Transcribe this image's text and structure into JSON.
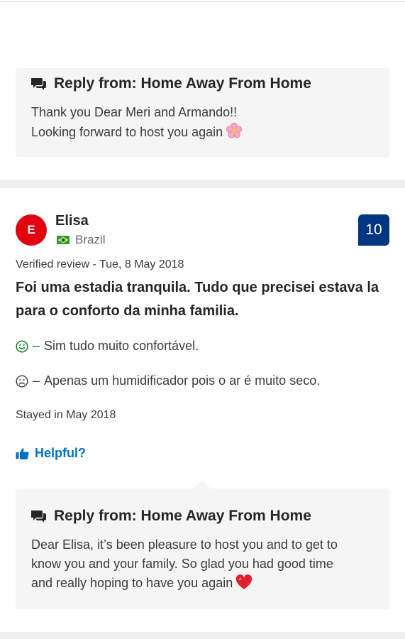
{
  "reply_1": {
    "heading": "Reply from: Home Away From Home",
    "line_1": "Thank you Dear Meri and Armando!!",
    "line_2": "Looking forward to host you again",
    "emoji_icon": "cherry-blossom-icon"
  },
  "review": {
    "avatar_letter": "E",
    "reviewer_name": "Elisa",
    "country": "Brazil",
    "flag_icon": "brazil-flag-icon",
    "score": "10",
    "verified": "Verified review - Tue, 8 May 2018",
    "title": "Foi uma estadia tranquila. Tudo que precisei estava la para o conforto da minha familia.",
    "pro_dash": "–",
    "pro_text": "Sim tudo muito confortável.",
    "con_dash": "–",
    "con_text": "Apenas um humidificador pois o ar é muito seco.",
    "stayed": "Stayed in May 2018",
    "helpful_label": "Helpful?"
  },
  "reply_2": {
    "heading": "Reply from: Home Away From Home",
    "line_1": "Dear Elisa, it’s been pleasure to host you and to get to",
    "line_2": "know you and your family. So glad you had good time",
    "line_3": "and really hoping to have you again",
    "emoji_icon": "red-heart-icon"
  },
  "colors": {
    "accent_blue": "#0071c2",
    "score_badge": "#003580",
    "avatar_red": "#e3000f",
    "pro_green": "#008009",
    "reply_bg": "#f5f5f5"
  }
}
